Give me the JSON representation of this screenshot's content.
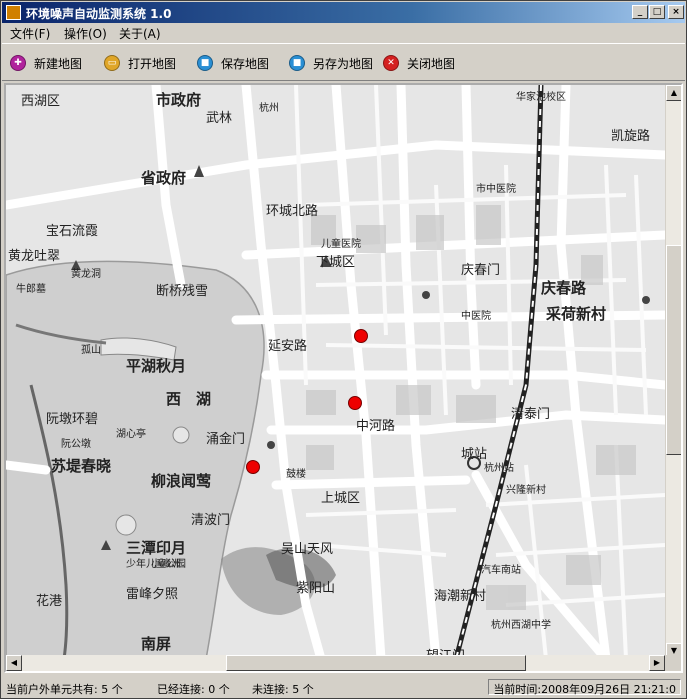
{
  "window": {
    "title": "环境噪声自动监测系统 1.0",
    "controls": {
      "minimize": "_",
      "maximize": "□",
      "close": "×"
    }
  },
  "menu": [
    {
      "label": "文件(F)"
    },
    {
      "label": "操作(O)"
    },
    {
      "label": "关于(A)"
    }
  ],
  "toolbar": [
    {
      "label": "新建地图",
      "icon": "new-map-icon",
      "color": "#b0239c"
    },
    {
      "label": "打开地图",
      "icon": "open-map-icon",
      "color": "#e0a628"
    },
    {
      "label": "保存地图",
      "icon": "save-map-icon",
      "color": "#2a8fd4"
    },
    {
      "label": "另存为地图",
      "icon": "save-as-map-icon",
      "color": "#2a8fd4"
    },
    {
      "label": "关闭地图",
      "icon": "close-map-icon",
      "color": "#d42020"
    }
  ],
  "map": {
    "labels": [
      {
        "text": "市政府",
        "cls": "big"
      },
      {
        "text": "武林",
        "cls": ""
      },
      {
        "text": "杭州",
        "cls": "small"
      },
      {
        "text": "省政府",
        "cls": "big"
      },
      {
        "text": "西湖区",
        "cls": ""
      },
      {
        "text": "宝石流霞",
        "cls": ""
      },
      {
        "text": "黄龙吐翠",
        "cls": ""
      },
      {
        "text": "牛郎墓",
        "cls": "small"
      },
      {
        "text": "黄龙洞",
        "cls": "small"
      },
      {
        "text": "断桥残雪",
        "cls": ""
      },
      {
        "text": "平湖秋月",
        "cls": "big"
      },
      {
        "text": "孤山",
        "cls": "small"
      },
      {
        "text": "西",
        "cls": "big"
      },
      {
        "text": "湖",
        "cls": "big"
      },
      {
        "text": "阮墩环碧",
        "cls": ""
      },
      {
        "text": "阮公墩",
        "cls": "small"
      },
      {
        "text": "湖心亭",
        "cls": "small"
      },
      {
        "text": "苏堤春晓",
        "cls": "big"
      },
      {
        "text": "柳浪闻莺",
        "cls": "big"
      },
      {
        "text": "涌金门",
        "cls": ""
      },
      {
        "text": "三潭印月",
        "cls": "big"
      },
      {
        "text": "小瀛洲",
        "cls": "small"
      },
      {
        "text": "少年儿童公园",
        "cls": "small"
      },
      {
        "text": "雷峰夕照",
        "cls": ""
      },
      {
        "text": "花港",
        "cls": ""
      },
      {
        "text": "南屏",
        "cls": "big"
      },
      {
        "text": "紫阳山",
        "cls": ""
      },
      {
        "text": "吴山天风",
        "cls": ""
      },
      {
        "text": "上城区",
        "cls": ""
      },
      {
        "text": "下城区",
        "cls": ""
      },
      {
        "text": "清波门",
        "cls": ""
      },
      {
        "text": "采荷新村",
        "cls": "big"
      },
      {
        "text": "杭州站",
        "cls": "small"
      },
      {
        "text": "兴隆新村",
        "cls": "small"
      },
      {
        "text": "凯旋路",
        "cls": ""
      },
      {
        "text": "清泰门",
        "cls": ""
      },
      {
        "text": "庆春门",
        "cls": ""
      },
      {
        "text": "庆春路",
        "cls": "big"
      },
      {
        "text": "华家池校区",
        "cls": "small"
      },
      {
        "text": "儿童医院",
        "cls": "small"
      },
      {
        "text": "汽车南站",
        "cls": "small"
      },
      {
        "text": "杭州西湖中学",
        "cls": "small"
      },
      {
        "text": "海潮新村",
        "cls": ""
      },
      {
        "text": "中医院",
        "cls": "small"
      },
      {
        "text": "市中医院",
        "cls": "small"
      },
      {
        "text": "望江门",
        "cls": ""
      },
      {
        "text": "城站",
        "cls": ""
      },
      {
        "text": "鼓楼",
        "cls": "small"
      },
      {
        "text": "延安路",
        "cls": ""
      },
      {
        "text": "中河路",
        "cls": ""
      },
      {
        "text": "环城北路",
        "cls": ""
      }
    ],
    "markers": [
      {
        "name": "monitor-unit-1"
      },
      {
        "name": "monitor-unit-2"
      },
      {
        "name": "monitor-unit-3"
      }
    ]
  },
  "status": {
    "total": "当前户外单元共有: 5 个",
    "connected": "已经连接: 0 个",
    "disconnected": "未连接: 5 个",
    "time": "当前时间:2008年09月26日  21:21:0"
  },
  "colors": {
    "titlebar_start": "#0a246a",
    "titlebar_end": "#a6caf0",
    "marker": "#ee0000",
    "window_bg": "#d4d0c8"
  }
}
